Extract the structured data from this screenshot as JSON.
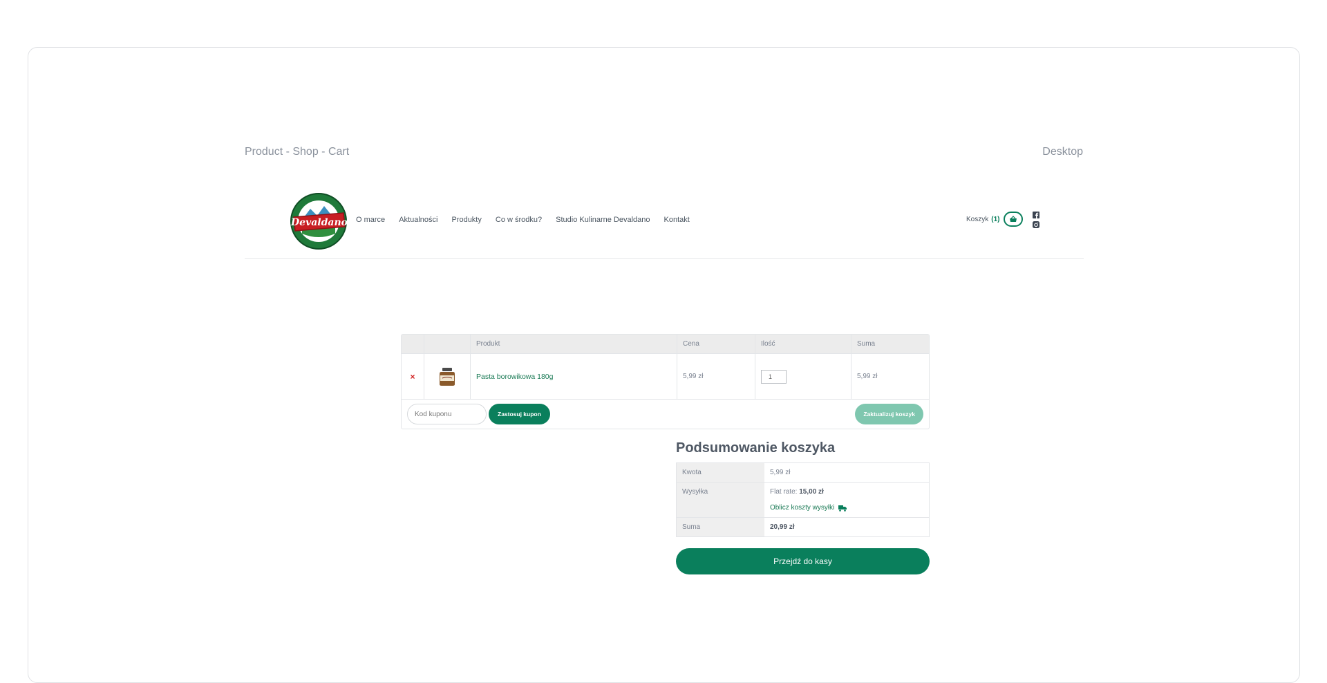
{
  "page": {
    "label_left": "Product - Shop - Cart",
    "label_right": "Desktop"
  },
  "header": {
    "logo_text": "Devaldano",
    "nav": [
      "O marce",
      "Aktualności",
      "Produkty",
      "Co w środku?",
      "Studio Kulinarne Devaldano",
      "Kontakt"
    ],
    "cart_label": "Koszyk",
    "cart_count": "(1)",
    "social": [
      "facebook-icon",
      "instagram-icon"
    ]
  },
  "cart": {
    "columns": {
      "product": "Produkt",
      "price": "Cena",
      "qty": "Ilość",
      "total": "Suma"
    },
    "items": [
      {
        "remove": "×",
        "name": "Pasta borowikowa 180g",
        "price": "5,99 zł",
        "qty": "1",
        "total": "5,99 zł"
      }
    ],
    "coupon_placeholder": "Kod kuponu",
    "apply_coupon": "Zastosuj kupon",
    "update_cart": "Zaktualizuj koszyk"
  },
  "totals": {
    "title": "Podsumowanie koszyka",
    "subtotal_label": "Kwota",
    "subtotal": "5,99 zł",
    "shipping_label": "Wysyłka",
    "shipping_method": "Flat rate:",
    "shipping_price": "15,00 zł",
    "shipping_calc": "Oblicz koszty wysyłki",
    "total_label": "Suma",
    "total": "20,99 zł",
    "checkout": "Przejdź do kasy"
  },
  "colors": {
    "accent": "#0a7f5c",
    "accent_light": "#7fc7af",
    "remove": "#d12020"
  }
}
